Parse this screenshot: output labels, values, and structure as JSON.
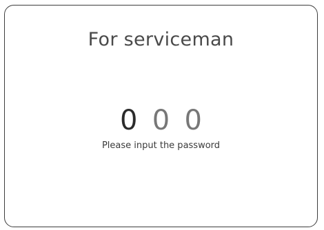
{
  "dialog": {
    "title": "For serviceman",
    "password_digits": [
      {
        "value": "0",
        "state": "active"
      },
      {
        "value": "0",
        "state": "inactive"
      },
      {
        "value": "0",
        "state": "inactive"
      }
    ],
    "hint": "Please input the password"
  },
  "colors": {
    "border": "#3c3c3c",
    "title": "#4a4a4a",
    "active_digit": "#2b2b2b",
    "inactive_digit": "#777777",
    "hint": "#3a3a3a"
  }
}
